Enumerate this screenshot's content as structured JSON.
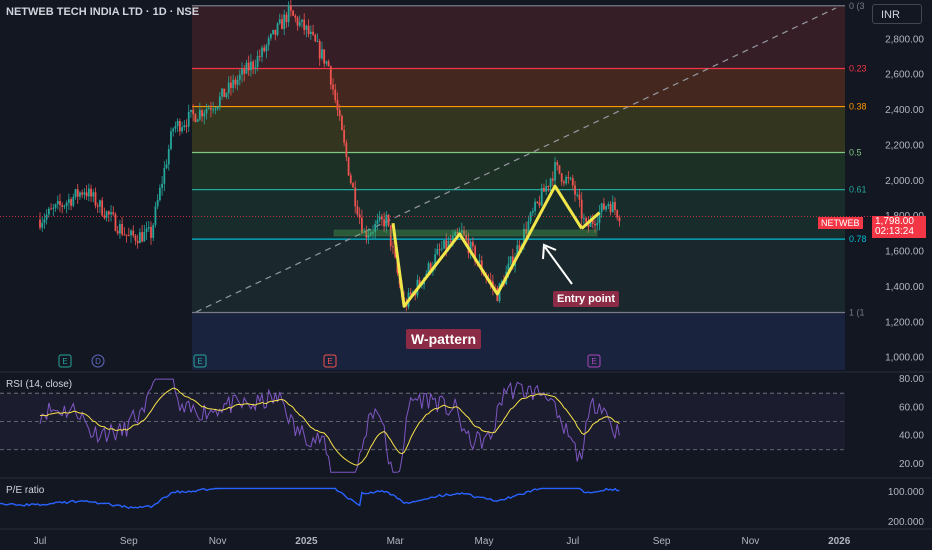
{
  "header": {
    "title": "NETWEB TECH INDIA LTD · 1D · NSE"
  },
  "currency": "INR",
  "price_tag": {
    "symbol": "NETWEB",
    "price": "1,798.00",
    "countdown": "02:13:24"
  },
  "annotations": {
    "pattern": "W-pattern",
    "entry": "Entry point"
  },
  "colors": {
    "up": "#26a69a",
    "down": "#ef5350",
    "rsi": "#7e57c2",
    "ma": "#f7e24a",
    "pe": "#2962ff",
    "drawing": "#f1e64a"
  },
  "chart_data": [
    {
      "type": "candlestick",
      "title": "NETWEB TECH INDIA LTD · 1D · NSE",
      "y_ticks": [
        1000,
        1200,
        1400,
        1600,
        1800,
        2000,
        2200,
        2400,
        2600,
        2800
      ],
      "y_tick_labels": [
        "1,000.00",
        "1,200.00",
        "1,400.00",
        "1,600.00",
        "1,800.00",
        "2,000.00",
        "2,200.00",
        "2,400.00",
        "2,600.00",
        "2,800.00"
      ],
      "ylim": [
        930,
        3000
      ],
      "x_tick_labels": [
        "Jul",
        "Sep",
        "Nov",
        "2025",
        "Mar",
        "May",
        "Jul",
        "Sep",
        "Nov",
        "2026"
      ],
      "price_trend": [
        {
          "m": 0,
          "v": 1780
        },
        {
          "m": 1,
          "v": 1950
        },
        {
          "m": 2,
          "v": 1680
        },
        {
          "m": 2.5,
          "v": 1700
        },
        {
          "m": 3,
          "v": 2300
        },
        {
          "m": 4,
          "v": 2450
        },
        {
          "m": 5,
          "v": 2720
        },
        {
          "m": 5.6,
          "v": 2950
        },
        {
          "m": 6,
          "v": 2850
        },
        {
          "m": 6.5,
          "v": 2650
        },
        {
          "m": 7,
          "v": 2000
        },
        {
          "m": 7.3,
          "v": 1700
        },
        {
          "m": 7.8,
          "v": 1780
        },
        {
          "m": 8.2,
          "v": 1290
        },
        {
          "m": 9,
          "v": 1600
        },
        {
          "m": 9.5,
          "v": 1700
        },
        {
          "m": 10,
          "v": 1480
        },
        {
          "m": 10.3,
          "v": 1360
        },
        {
          "m": 11,
          "v": 1760
        },
        {
          "m": 11.6,
          "v": 2070
        },
        {
          "m": 12,
          "v": 1970
        },
        {
          "m": 12.3,
          "v": 1730
        },
        {
          "m": 12.8,
          "v": 1880
        },
        {
          "m": 13.1,
          "v": 1798
        }
      ],
      "fibonacci": [
        {
          "ratio": "0 (3",
          "price": 2990,
          "color": "#787b86",
          "fill": "#3a1f27"
        },
        {
          "ratio": "0.23",
          "price": 2635,
          "color": "#f23645",
          "fill": "#4a2a1f"
        },
        {
          "ratio": "0.38",
          "price": 2420,
          "color": "#ff9800",
          "fill": "#38381f"
        },
        {
          "ratio": "0.5",
          "price": 2160,
          "color": "#81c784",
          "fill": "#1f3326"
        },
        {
          "ratio": "0.61",
          "price": 1950,
          "color": "#26a69a",
          "fill": "#1a2f2d"
        },
        {
          "ratio": "0.78",
          "price": 1670,
          "color": "#00bcd4",
          "fill": "#1c2a30"
        },
        {
          "ratio": "1 (1",
          "price": 1255,
          "color": "#787b86",
          "fill": "#1c2540"
        }
      ],
      "w_pattern_points": [
        {
          "m": 7.95,
          "v": 1760
        },
        {
          "m": 8.2,
          "v": 1290
        },
        {
          "m": 9.45,
          "v": 1700
        },
        {
          "m": 10.3,
          "v": 1360
        },
        {
          "m": 11.6,
          "v": 1970
        },
        {
          "m": 12.2,
          "v": 1730
        }
      ]
    },
    {
      "type": "line",
      "title": "RSI (14, close)",
      "y_ticks": [
        20,
        40,
        60,
        80
      ],
      "y_tick_labels": [
        "20.00",
        "40.00",
        "60.00",
        "80.00"
      ],
      "bands": [
        30,
        50,
        70
      ]
    },
    {
      "type": "line",
      "title": "P/E ratio",
      "y_ticks": [
        100,
        200
      ],
      "y_tick_labels": [
        "100.000",
        "200.000"
      ]
    }
  ]
}
